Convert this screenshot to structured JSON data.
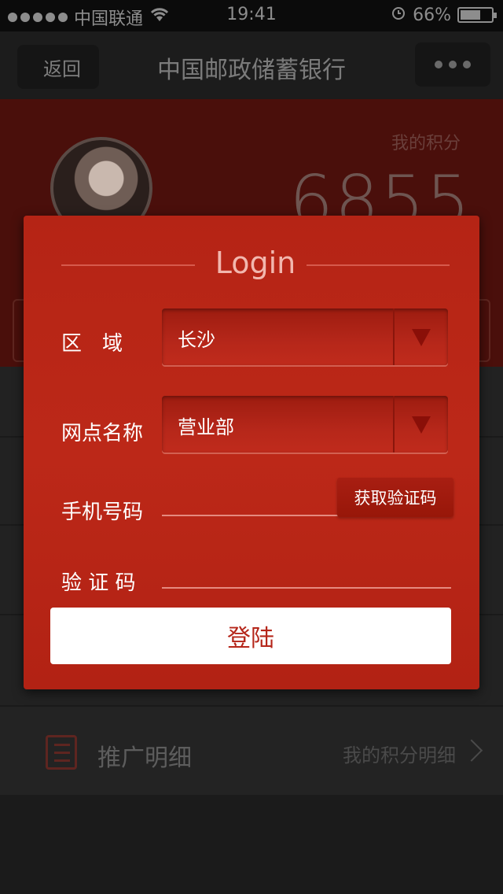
{
  "status_bar": {
    "carrier": "中国联通",
    "time": "19:41",
    "battery": "66%",
    "battery_level": 0.66
  },
  "navbar": {
    "back_label": "返回",
    "title": "中国邮政储蓄银行",
    "more_icon": "more-dots-icon"
  },
  "profile": {
    "points_label": "我的积分",
    "points_value": "6855"
  },
  "list": {
    "item_label": "推广明细",
    "item_right": "我的积分明细",
    "item_icon": "list-icon"
  },
  "login_modal": {
    "title": "Login",
    "region_label": "区　域",
    "region_value": "长沙",
    "branch_label": "网点名称",
    "branch_value": "营业部",
    "phone_label": "手机号码",
    "get_code_label": "获取验证码",
    "code_label": "验 证 码",
    "submit_label": "登陆"
  }
}
